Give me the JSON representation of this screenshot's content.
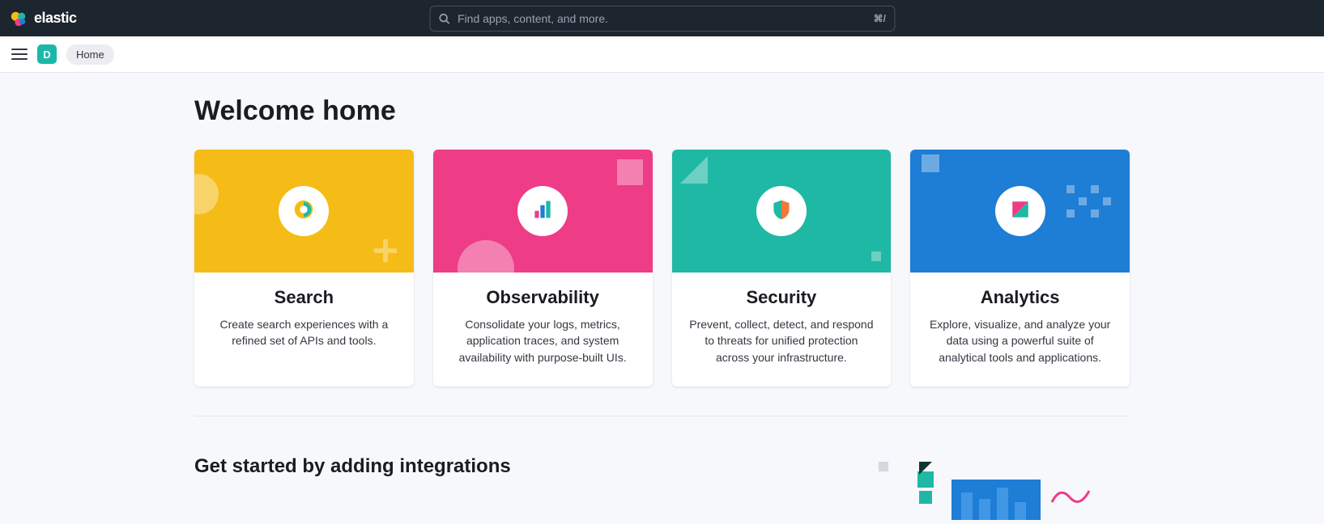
{
  "brand": {
    "name": "elastic"
  },
  "search": {
    "placeholder": "Find apps, content, and more.",
    "shortcut": "⌘/"
  },
  "space": {
    "initial": "D"
  },
  "breadcrumb": {
    "home": "Home"
  },
  "page": {
    "title": "Welcome home"
  },
  "cards": [
    {
      "title": "Search",
      "desc": "Create search experiences with a refined set of APIs and tools."
    },
    {
      "title": "Observability",
      "desc": "Consolidate your logs, metrics, application traces, and system availability with purpose-built UIs."
    },
    {
      "title": "Security",
      "desc": "Prevent, collect, detect, and respond to threats for unified protection across your infrastructure."
    },
    {
      "title": "Analytics",
      "desc": "Explore, visualize, and analyze your data using a powerful suite of analytical tools and applications."
    }
  ],
  "sections": {
    "integrations_title": "Get started by adding integrations"
  }
}
